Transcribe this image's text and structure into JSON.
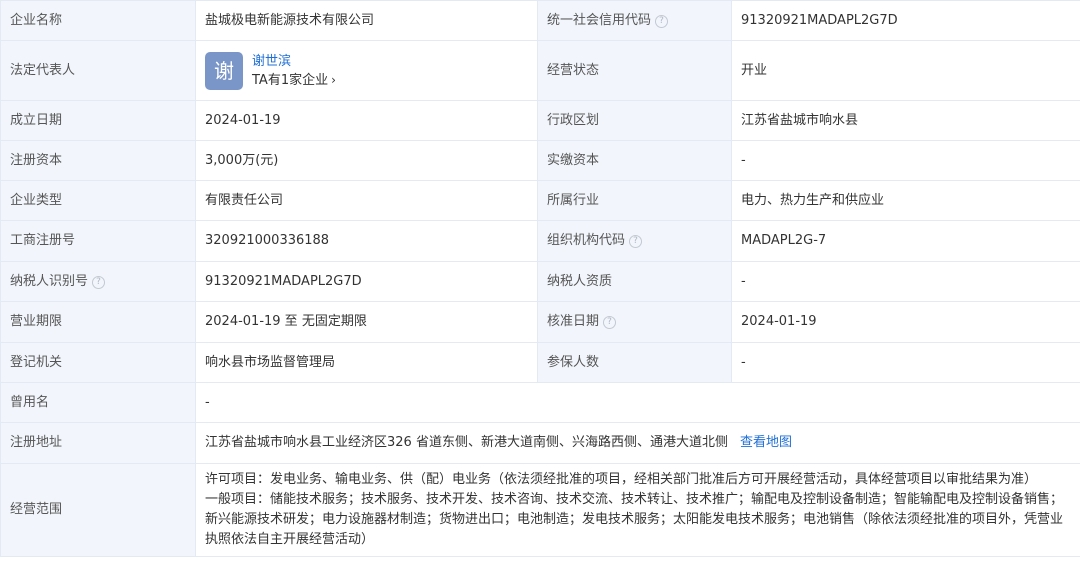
{
  "rows": [
    {
      "label1": "企业名称",
      "value1": "盐城极电新能源技术有限公司",
      "label2": "统一社会信用代码",
      "help2": true,
      "value2": "91320921MADAPL2G7D"
    },
    {
      "label1": "法定代表人",
      "label2": "经营状态",
      "value2": "开业"
    },
    {
      "label1": "成立日期",
      "value1": "2024-01-19",
      "label2": "行政区划",
      "value2": "江苏省盐城市响水县"
    },
    {
      "label1": "注册资本",
      "value1": "3,000万(元)",
      "label2": "实缴资本",
      "value2": "-"
    },
    {
      "label1": "企业类型",
      "value1": "有限责任公司",
      "label2": "所属行业",
      "value2": "电力、热力生产和供应业"
    },
    {
      "label1": "工商注册号",
      "value1": "320921000336188",
      "label2": "组织机构代码",
      "help2": true,
      "value2": "MADAPL2G-7"
    },
    {
      "label1": "纳税人识别号",
      "help1": true,
      "value1": "91320921MADAPL2G7D",
      "label2": "纳税人资质",
      "value2": "-"
    },
    {
      "label1": "营业期限",
      "value1": "2024-01-19 至 无固定期限",
      "label2": "核准日期",
      "help2": true,
      "value2": "2024-01-19"
    },
    {
      "label1": "登记机关",
      "value1": "响水县市场监督管理局",
      "label2": "参保人数",
      "value2": "-"
    }
  ],
  "legal_rep": {
    "avatar_char": "谢",
    "name": "谢世滨",
    "link_text": "TA有1家企业"
  },
  "former_name": {
    "label": "曾用名",
    "value": "-"
  },
  "address": {
    "label": "注册地址",
    "value": "江苏省盐城市响水县工业经济区326 省道东侧、新港大道南侧、兴海路西侧、通港大道北侧",
    "map_link": "查看地图"
  },
  "scope": {
    "label": "经营范围",
    "line1": "许可项目：发电业务、输电业务、供（配）电业务（依法须经批准的项目，经相关部门批准后方可开展经营活动，具体经营项目以审批结果为准）",
    "line2": "一般项目：储能技术服务；技术服务、技术开发、技术咨询、技术交流、技术转让、技术推广；输配电及控制设备制造；智能输配电及控制设备销售；新兴能源技术研发；电力设施器材制造；货物进出口；电池制造；发电技术服务；太阳能发电技术服务；电池销售（除依法须经批准的项目外，凭营业执照依法自主开展经营活动）"
  },
  "help_glyph": "?"
}
